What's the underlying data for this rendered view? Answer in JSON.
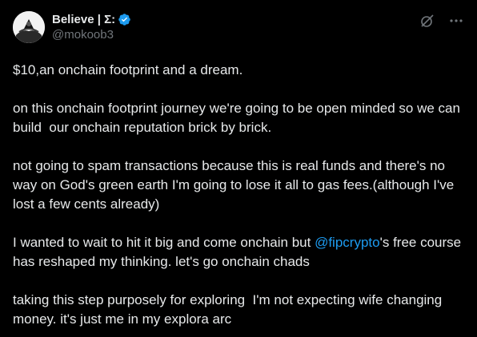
{
  "author": {
    "display_name": "Believe | Σ:",
    "handle": "@mokoob3",
    "verified": true
  },
  "icons": {
    "avatar": "avatar-image",
    "verified": "verified-badge-icon",
    "grok": "grok-icon",
    "more": "more-options-icon"
  },
  "colors": {
    "background": "#000000",
    "text": "#e7e9ea",
    "secondary": "#71767b",
    "accent": "#1d9bf0"
  },
  "tweet": {
    "p1": "$10,an onchain footprint and a dream.",
    "p2": "on this onchain footprint journey we're going to be open minded so we can build  our onchain reputation brick by brick.",
    "p3": "not going to spam transactions because this is real funds and there's no way on God's green earth I'm going to lose it all to gas fees.(although I've lost a few cents already)",
    "p4_before": "I wanted to wait to hit it big and come onchain but ",
    "p4_mention": "@fipcrypto",
    "p4_after": "'s free course has reshaped my thinking. let's go onchain chads",
    "p5": "taking this step purposely for exploring  I'm not expecting wife changing money. it's just me in my explora arc"
  }
}
